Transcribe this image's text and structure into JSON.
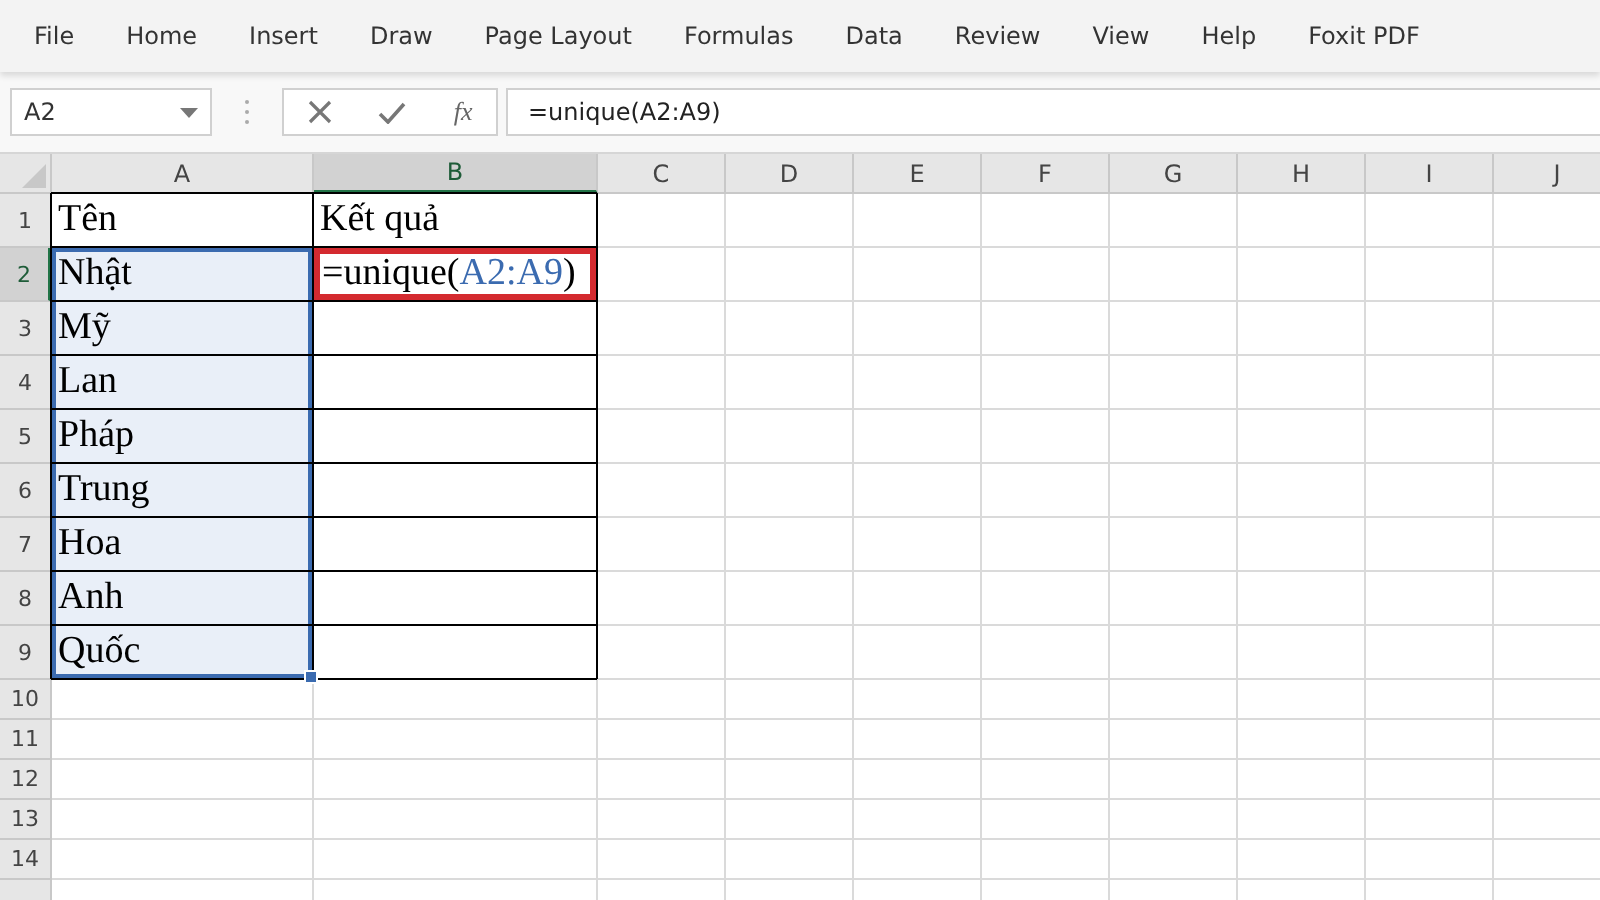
{
  "menu": [
    "File",
    "Home",
    "Insert",
    "Draw",
    "Page Layout",
    "Formulas",
    "Data",
    "Review",
    "View",
    "Help",
    "Foxit PDF"
  ],
  "name_box": {
    "value": "A2"
  },
  "formula_bar": {
    "function_label": "fx",
    "value": "=unique(A2:A9)"
  },
  "columns": [
    {
      "label": "A",
      "selected": false
    },
    {
      "label": "B",
      "selected": true
    },
    {
      "label": "C",
      "selected": false
    },
    {
      "label": "D",
      "selected": false
    },
    {
      "label": "E",
      "selected": false
    },
    {
      "label": "F",
      "selected": false
    },
    {
      "label": "G",
      "selected": false
    },
    {
      "label": "H",
      "selected": false
    },
    {
      "label": "I",
      "selected": false
    },
    {
      "label": "J",
      "selected": false
    }
  ],
  "rows": [
    {
      "number": "1",
      "selected": false,
      "cells": [
        {
          "text": "Tên",
          "in_range": false
        },
        {
          "text": "Kết quả",
          "in_range": false,
          "annotated": false
        }
      ]
    },
    {
      "number": "2",
      "selected": true,
      "cells": [
        {
          "text": "Nhật",
          "in_range": true
        },
        {
          "parts": [
            {
              "text": "=unique(",
              "reference": false
            },
            {
              "text": "A2:A9",
              "reference": true
            },
            {
              "text": ")",
              "reference": false
            }
          ],
          "in_range": false,
          "annotated": true
        }
      ]
    },
    {
      "number": "3",
      "selected": false,
      "cells": [
        {
          "text": "Mỹ",
          "in_range": true
        }
      ]
    },
    {
      "number": "4",
      "selected": false,
      "cells": [
        {
          "text": "Lan",
          "in_range": true
        }
      ]
    },
    {
      "number": "5",
      "selected": false,
      "cells": [
        {
          "text": "Pháp",
          "in_range": true
        }
      ]
    },
    {
      "number": "6",
      "selected": false,
      "cells": [
        {
          "text": "Trung",
          "in_range": true
        }
      ]
    },
    {
      "number": "7",
      "selected": false,
      "cells": [
        {
          "text": "Hoa",
          "in_range": true
        }
      ]
    },
    {
      "number": "8",
      "selected": false,
      "cells": [
        {
          "text": "Anh",
          "in_range": true
        }
      ]
    },
    {
      "number": "9",
      "selected": false,
      "cells": [
        {
          "text": "Quốc",
          "in_range": true
        }
      ]
    },
    {
      "number": "10",
      "selected": false
    },
    {
      "number": "11",
      "selected": false
    },
    {
      "number": "12",
      "selected": false
    },
    {
      "number": "13",
      "selected": false
    },
    {
      "number": "14",
      "selected": false
    }
  ]
}
